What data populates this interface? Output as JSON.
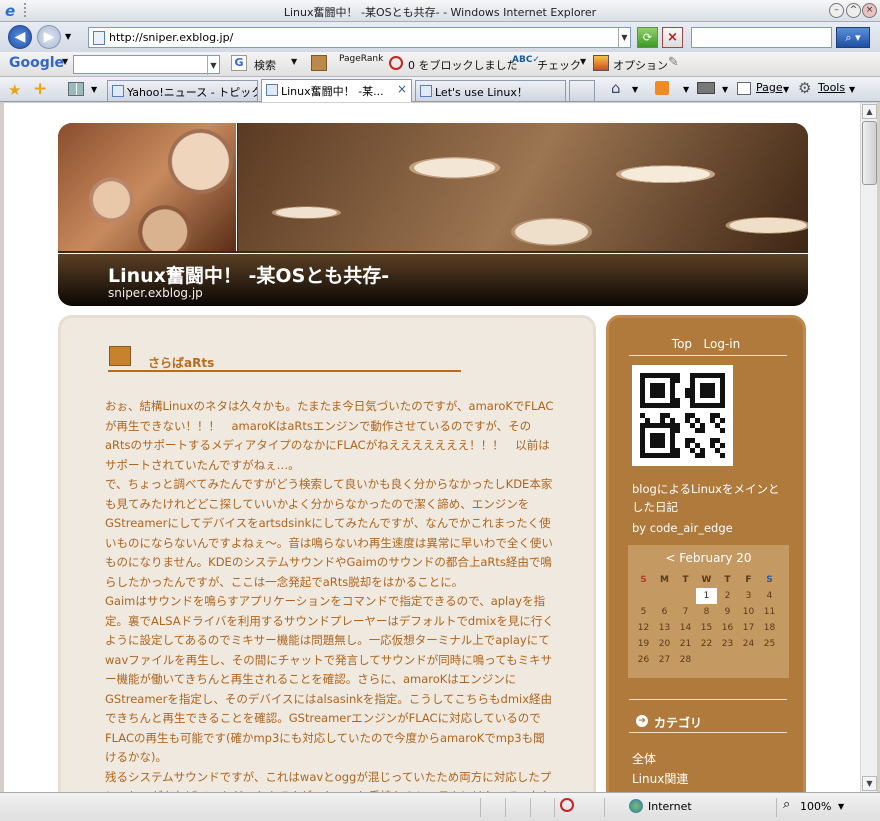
{
  "window": {
    "title": "Linux奮闘中！ -某OSとも共存- - Windows Internet Explorer"
  },
  "address": {
    "url": "http://sniper.exblog.jp/"
  },
  "google_bar": {
    "brand": "Google",
    "search_label": "検索",
    "pagerank_label": "PageRank",
    "blocked_label": "0 をブロックしました",
    "check_label": "チェック",
    "options_label": "オプション"
  },
  "tabs": [
    {
      "label": "Yahoo!ニュース - トピックス",
      "active": false
    },
    {
      "label": "Linux奮闘中！ -某...",
      "active": true
    },
    {
      "label": "Let's use Linux！",
      "active": false
    }
  ],
  "toolbar_right": {
    "page_label": "Page",
    "tools_label": "Tools"
  },
  "blog": {
    "title": "Linux奮闘中！ -某OSとも共存-",
    "subtitle": "sniper.exblog.jp",
    "entry_title": "さらばaRts",
    "paragraphs": [
      "おぉ、結構Linuxのネタは久々かも。たまたま今日気づいたのですが、amaroKでFLACが再生できない！！！　amaroKはaRtsエンジンで動作させているのですが、そのaRtsのサポートするメディアタイプのなかにFLACがねえええええええ！！！　以前はサポートされていたんですがねぇ…。",
      "で、ちょっと調べてみたんですがどう検索して良いかも良く分からなかったしKDE本家も見てみたけれどどこ探していいかよく分からなかったので潔く諦め、エンジンをGStreamerにしてデバイスをartsdsinkにしてみたんですが、なんでかこれまったく使いものにならないんですよねぇ〜。音は鳴らないわ再生速度は異常に早いわで全く使いものになりません。KDEのシステムサウンドやGaimのサウンドの都合上aRts経由で鳴らしたかったんですが、ここは一念発起でaRts脱却をはかることに。",
      "Gaimはサウンドを鳴らすアプリケーションをコマンドで指定できるので、aplayを指定。裏でALSAドライバを利用するサウンドプレーヤーはデフォルトでdmixを見に行くように設定してあるのでミキサー機能は問題無し。一応仮想ターミナル上でaplayにてwavファイルを再生し、その間にチャットで発言してサウンドが同時に鳴ってもミキサー機能が働いてきちんと再生されることを確認。さらに、amaroKはエンジンにGStreamerを指定し、そのデバイスにはalsasinkを指定。こうしてこちらもdmix経由できちんと再生できることを確認。GStreamerエンジンがFLACに対応しているのでFLACの再生も可能です(確かmp3にも対応していたので今度からamaroKでmp3も聞けるかな)。",
      "残るシステムサウンドですが、これはwavとoggが混じっていたため両方に対応したプレーヤーがあればベストだったんですが、ちょっと手持ちのシステムには入っていなかったためOggで統一。"
    ]
  },
  "sidebar": {
    "top_label": "Top",
    "login_label": "Log-in",
    "description": "blogによるLinuxをメインとした日記",
    "author": "by code_air_edge",
    "calendar": {
      "month_label": "< February 20",
      "weekdays": [
        "S",
        "M",
        "T",
        "W",
        "T",
        "F",
        "S"
      ],
      "weeks": [
        [
          "",
          "",
          "",
          "1",
          "2",
          "3",
          "4"
        ],
        [
          "5",
          "6",
          "7",
          "8",
          "9",
          "10",
          "11"
        ],
        [
          "12",
          "13",
          "14",
          "15",
          "16",
          "17",
          "18"
        ],
        [
          "19",
          "20",
          "21",
          "22",
          "23",
          "24",
          "25"
        ],
        [
          "26",
          "27",
          "28",
          "",
          "",
          "",
          ""
        ]
      ],
      "today": "1"
    },
    "category_title": "カテゴリ",
    "categories": [
      "全体",
      "Linux関連"
    ]
  },
  "status": {
    "zone": "Internet",
    "zoom": "100%"
  }
}
